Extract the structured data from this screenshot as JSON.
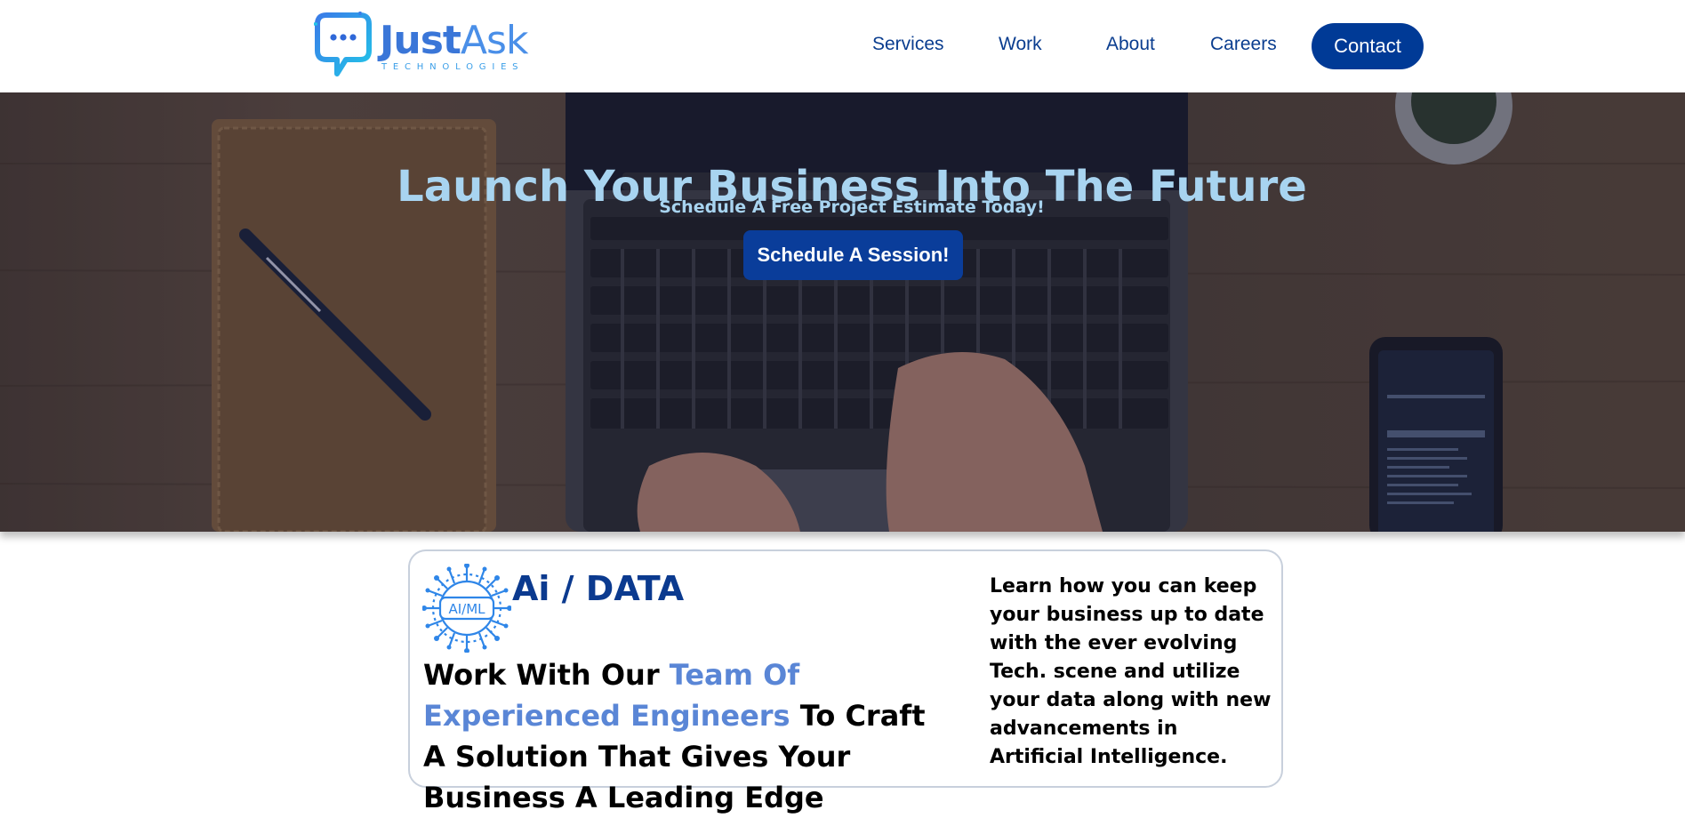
{
  "brand": {
    "name_part1": "Just",
    "name_part2": "Ask",
    "tagline": "TECHNOLOGIES",
    "primary_color": "#0a3d8f",
    "accent_color": "#4a86e8"
  },
  "nav": {
    "services": "Services",
    "work": "Work",
    "about": "About",
    "careers": "Careers",
    "contact": "Contact"
  },
  "hero": {
    "title": "Launch Your Business Into The Future",
    "subtitle": "Schedule A Free Project Estimate Today!",
    "cta_label": "Schedule A Session!",
    "background": "laptop-on-desk-photo"
  },
  "card": {
    "icon": "ai-ml-chip-icon",
    "icon_label": "AI/ML",
    "title": "Ai / DATA",
    "headline_part1": "Work With Our ",
    "headline_highlight": "Team Of Experienced Engineers",
    "headline_part2": " To Craft A Solution That Gives Your Business A Leading Edge",
    "description": "Learn how you can keep your business up to date with the ever evolving Tech. scene and utilize your data along with new advancements in Artificial Intelligence."
  }
}
